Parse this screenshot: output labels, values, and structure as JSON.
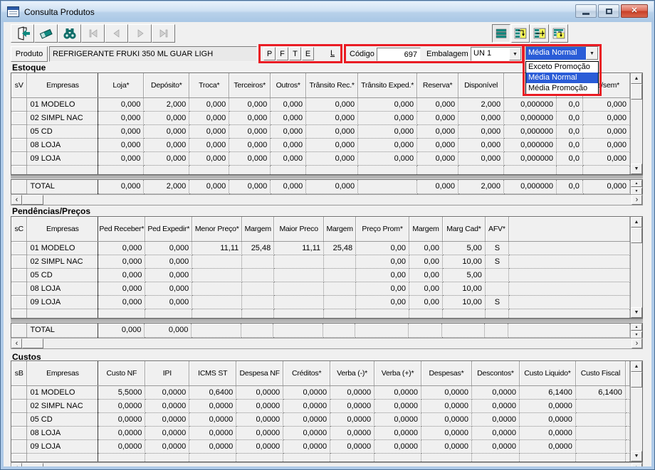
{
  "window": {
    "title": "Consulta Produtos"
  },
  "titlebar": {
    "icons": [
      "minimize-icon",
      "maximize-icon",
      "close-icon"
    ]
  },
  "toolbar": {
    "left_icons": [
      "exit-door-icon",
      "eraser-icon",
      "binoculars-search-icon",
      "nav-first-icon",
      "nav-previous-icon",
      "nav-next-icon",
      "nav-last-icon"
    ],
    "right_icons": [
      "view-grid-rows-icon",
      "view-detail-right-icon",
      "view-detail-transfer-icon",
      "view-detail-bottom-icon"
    ]
  },
  "annotations": {
    "highlight_color": "#ea1c24"
  },
  "colors": {
    "selection_blue": "#2a5cd7",
    "icon_teal": "#0f8a80"
  },
  "product_bar": {
    "produto_label": "Produto",
    "product_name": "REFRIGERANTE FRUKI 350 ML GUAR LIGH",
    "flag_buttons": [
      "P",
      "F",
      "T",
      "E"
    ],
    "l_label": "L",
    "codigo_label": "Código",
    "codigo_value": "697",
    "embalagem_label": "Embalagem",
    "embalagem_value": "UN 1",
    "media_combo": {
      "value": "Média Normal",
      "options": [
        "Exceto Promoção",
        "Média Normal",
        "Média Promoção"
      ],
      "selected_index": 1
    }
  },
  "sections": {
    "estoque": {
      "label": "Estoque",
      "headers": [
        "sV",
        "Empresas",
        "Loja*",
        "Depósito*",
        "Troca*",
        "Terceiros*",
        "Outros*",
        "Trânsito Rec.*",
        "Trânsito Exped.*",
        "Reserva*",
        "Disponível",
        "Ve",
        "",
        "da/sem*"
      ],
      "rows": [
        {
          "empresa": "01 MODELO",
          "values": [
            "0,000",
            "2,000",
            "0,000",
            "0,000",
            "0,000",
            "0,000",
            "0,000",
            "0,000",
            "2,000",
            "0,000000",
            "0,0",
            "0,000"
          ]
        },
        {
          "empresa": "02 SIMPL NAC",
          "values": [
            "0,000",
            "0,000",
            "0,000",
            "0,000",
            "0,000",
            "0,000",
            "0,000",
            "0,000",
            "0,000",
            "0,000000",
            "0,0",
            "0,000"
          ]
        },
        {
          "empresa": "05 CD",
          "values": [
            "0,000",
            "0,000",
            "0,000",
            "0,000",
            "0,000",
            "0,000",
            "0,000",
            "0,000",
            "0,000",
            "0,000000",
            "0,0",
            "0,000"
          ]
        },
        {
          "empresa": "08 LOJA",
          "values": [
            "0,000",
            "0,000",
            "0,000",
            "0,000",
            "0,000",
            "0,000",
            "0,000",
            "0,000",
            "0,000",
            "0,000000",
            "0,0",
            "0,000"
          ]
        },
        {
          "empresa": "09 LOJA",
          "values": [
            "0,000",
            "0,000",
            "0,000",
            "0,000",
            "0,000",
            "0,000",
            "0,000",
            "0,000",
            "0,000",
            "0,000000",
            "0,0",
            "0,000"
          ]
        }
      ],
      "total": {
        "label": "TOTAL",
        "values": [
          "0,000",
          "2,000",
          "0,000",
          "0,000",
          "0,000",
          "0,000",
          "",
          "0,000",
          "2,000",
          "0,000000",
          "0,0",
          "0,000"
        ]
      }
    },
    "pendencias": {
      "label": "Pendências/Preços",
      "headers": [
        "sC",
        "Empresas",
        "Ped Receber*",
        "Ped Expedir*",
        "Menor Preço*",
        "Margem",
        "Maior Preco",
        "Margem",
        "Preço Prom*",
        "Margem",
        "Marg Cad*",
        "AFV*",
        ""
      ],
      "rows": [
        {
          "empresa": "01 MODELO",
          "values": [
            "0,000",
            "0,000",
            "11,11",
            "25,48",
            "11,11",
            "25,48",
            "0,00",
            "0,00",
            "5,00",
            "S",
            ""
          ]
        },
        {
          "empresa": "02 SIMPL NAC",
          "values": [
            "0,000",
            "0,000",
            "",
            "",
            "",
            "",
            "0,00",
            "0,00",
            "10,00",
            "S",
            ""
          ]
        },
        {
          "empresa": "05 CD",
          "values": [
            "0,000",
            "0,000",
            "",
            "",
            "",
            "",
            "0,00",
            "0,00",
            "5,00",
            "",
            ""
          ]
        },
        {
          "empresa": "08 LOJA",
          "values": [
            "0,000",
            "0,000",
            "",
            "",
            "",
            "",
            "0,00",
            "0,00",
            "10,00",
            "",
            ""
          ]
        },
        {
          "empresa": "09 LOJA",
          "values": [
            "0,000",
            "0,000",
            "",
            "",
            "",
            "",
            "0,00",
            "0,00",
            "10,00",
            "S",
            ""
          ]
        }
      ],
      "total": {
        "label": "TOTAL",
        "values": [
          "0,000",
          "0,000",
          "",
          "",
          "",
          "",
          "",
          "",
          "",
          "",
          ""
        ]
      }
    },
    "custos": {
      "label": "Custos",
      "headers": [
        "sB",
        "Empresas",
        "Custo NF",
        "IPI",
        "ICMS ST",
        "Despesa NF",
        "Créditos*",
        "Verba (-)*",
        "Verba (+)*",
        "Despesas*",
        "Descontos*",
        "Custo Liquido*",
        "Custo Fiscal",
        ""
      ],
      "rows": [
        {
          "empresa": "01 MODELO",
          "values": [
            "5,5000",
            "0,0000",
            "0,6400",
            "0,0000",
            "0,0000",
            "0,0000",
            "0,0000",
            "0,0000",
            "0,0000",
            "6,1400",
            "6,1400",
            ""
          ]
        },
        {
          "empresa": "02 SIMPL NAC",
          "values": [
            "0,0000",
            "0,0000",
            "0,0000",
            "0,0000",
            "0,0000",
            "0,0000",
            "0,0000",
            "0,0000",
            "0,0000",
            "0,0000",
            "",
            ""
          ]
        },
        {
          "empresa": "05 CD",
          "values": [
            "0,0000",
            "0,0000",
            "0,0000",
            "0,0000",
            "0,0000",
            "0,0000",
            "0,0000",
            "0,0000",
            "0,0000",
            "0,0000",
            "",
            ""
          ]
        },
        {
          "empresa": "08 LOJA",
          "values": [
            "0,0000",
            "0,0000",
            "0,0000",
            "0,0000",
            "0,0000",
            "0,0000",
            "0,0000",
            "0,0000",
            "0,0000",
            "0,0000",
            "",
            ""
          ]
        },
        {
          "empresa": "09 LOJA",
          "values": [
            "0,0000",
            "0,0000",
            "0,0000",
            "0,0000",
            "0,0000",
            "0,0000",
            "0,0000",
            "0,0000",
            "0,0000",
            "0,0000",
            "",
            ""
          ]
        }
      ]
    }
  }
}
